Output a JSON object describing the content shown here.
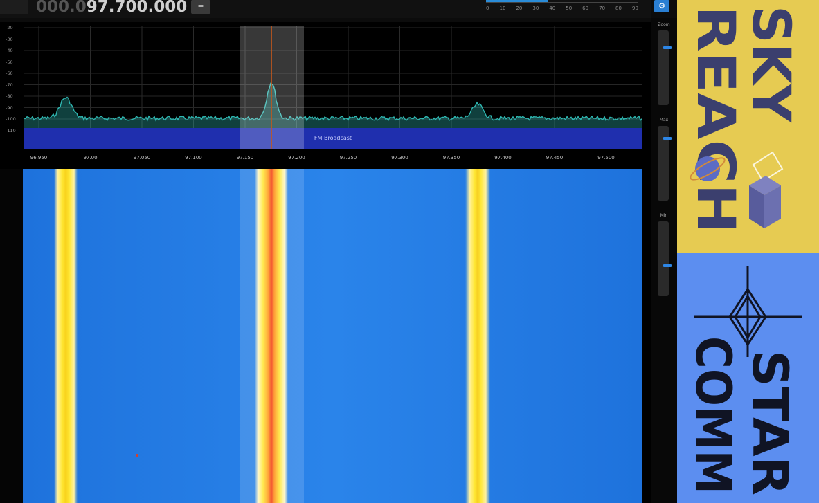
{
  "frequency": {
    "dim_prefix": "000.0",
    "value": "97.700.000",
    "button_icon": "menu-icon"
  },
  "smeter": {
    "ticks": [
      "0",
      "10",
      "20",
      "30",
      "40",
      "50",
      "60",
      "70",
      "80",
      "90"
    ],
    "level": 0.41
  },
  "corner_icon": "settings-icon",
  "spectrum": {
    "db_scale": [
      "-20",
      "-30",
      "-40",
      "-50",
      "-60",
      "-70",
      "-80",
      "-90",
      "-100",
      "-110"
    ],
    "band_label": "FM Broadcast",
    "freq_labels": [
      "96.950",
      "97.00",
      "97.050",
      "97.100",
      "97.150",
      "97.200",
      "97.250",
      "97.300",
      "97.350",
      "97.400",
      "97.450",
      "97.500"
    ],
    "colors": {
      "trace": "#2fb7b1",
      "band": "#1f2fae",
      "tuning": "#c0571d"
    }
  },
  "waterfall": {
    "colors": {
      "background": "#2a84ea",
      "hot": "#f23a10",
      "warm": "#ffe733"
    }
  },
  "controls": {
    "sliders": [
      {
        "label": "Zoom",
        "level": 0.78
      },
      {
        "label": "Max",
        "level": 0.85
      },
      {
        "label": "Min",
        "level": 0.4
      }
    ]
  },
  "logos": {
    "top": {
      "line1": "SKY",
      "line2": "REACH",
      "color_bg": "#e6cb52",
      "color_fg": "#3b3f6e"
    },
    "bottom": {
      "line1": "STAR",
      "line2": "COMM",
      "color_bg": "#5c8ef0",
      "color_fg": "#101424"
    }
  }
}
